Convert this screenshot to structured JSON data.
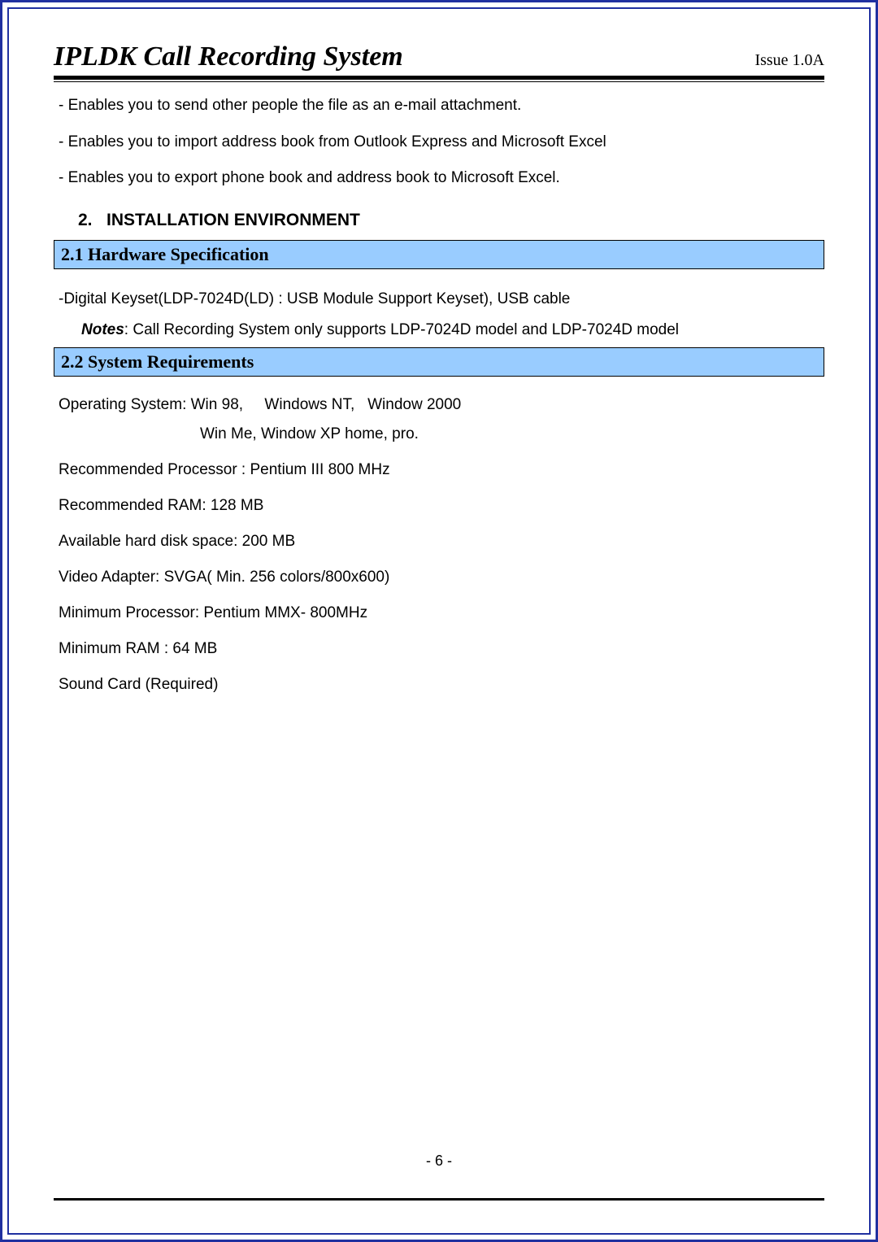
{
  "header": {
    "title": "IPLDK Call Recording System",
    "issue": "Issue 1.0A"
  },
  "bullets": {
    "b1": "- Enables you to send other people the file as an e-mail attachment.",
    "b2": "- Enables you to import address book from Outlook Express and Microsoft Excel",
    "b3": "- Enables you to export phone book and address book to Microsoft Excel."
  },
  "section2": {
    "heading": "2.   INSTALLATION ENVIRONMENT"
  },
  "sec21": {
    "heading": "2.1 Hardware Specification",
    "line1": "-Digital Keyset(LDP-7024D(LD) : USB Module Support Keyset),  USB cable",
    "notes_label": "Notes",
    "notes_text": ": Call Recording System only supports LDP-7024D model and LDP-7024D model"
  },
  "sec22": {
    "heading": "2.2 System Requirements",
    "os_line1": "Operating System: Win 98,     Windows NT,   Window 2000",
    "os_line2": "Win Me, Window XP home, pro.",
    "proc": "Recommended Processor : Pentium III 800 MHz",
    "ram": "Recommended RAM: 128 MB",
    "disk": "Available hard disk space: 200 MB",
    "video": "Video Adapter:  SVGA( Min. 256 colors/800x600)",
    "minproc": "Minimum Processor:  Pentium MMX- 800MHz",
    "minram": "Minimum RAM : 64 MB",
    "sound": "Sound Card (Required)"
  },
  "footer": {
    "page": "- 6 -"
  }
}
